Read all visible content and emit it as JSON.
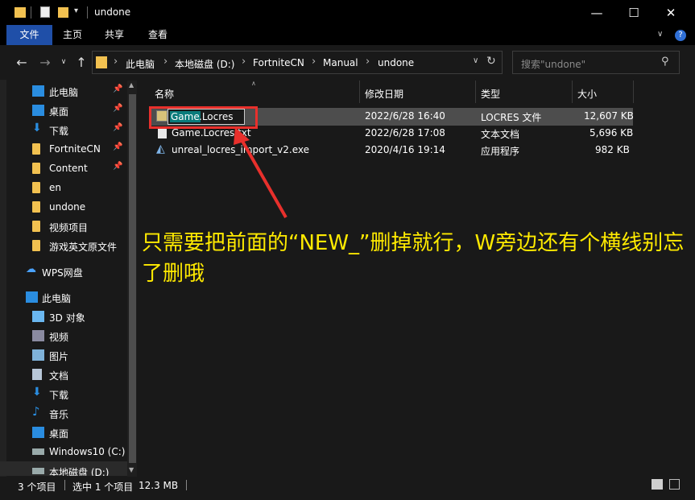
{
  "window": {
    "title": "undone",
    "controls": {
      "minimize": "—",
      "maximize": "☐",
      "close": "✕"
    }
  },
  "ribbon": {
    "tabs": [
      {
        "label": "文件",
        "active": true
      },
      {
        "label": "主页"
      },
      {
        "label": "共享"
      },
      {
        "label": "查看"
      }
    ]
  },
  "address": {
    "breadcrumb": [
      "此电脑",
      "本地磁盘 (D:)",
      "FortniteCN",
      "Manual",
      "undone"
    ],
    "search_placeholder": "搜索\"undone\""
  },
  "sidebar": {
    "items": [
      {
        "label": "此电脑",
        "icon": "pc-icon",
        "pinned": true
      },
      {
        "label": "桌面",
        "icon": "desktop-icon",
        "pinned": true
      },
      {
        "label": "下载",
        "icon": "download-icon",
        "pinned": true
      },
      {
        "label": "FortniteCN",
        "icon": "folder-icon",
        "pinned": true
      },
      {
        "label": "Content",
        "icon": "folder-icon",
        "pinned": true
      },
      {
        "label": "en",
        "icon": "folder-icon"
      },
      {
        "label": "undone",
        "icon": "folder-icon"
      },
      {
        "label": "视频项目",
        "icon": "folder-icon"
      },
      {
        "label": "游戏英文原文件",
        "icon": "folder-icon"
      },
      {
        "label": "WPS网盘",
        "icon": "cloud-icon"
      },
      {
        "label": "此电脑",
        "icon": "pc-icon"
      },
      {
        "label": "3D 对象",
        "icon": "3d-objects-icon"
      },
      {
        "label": "视频",
        "icon": "video-icon"
      },
      {
        "label": "图片",
        "icon": "picture-icon"
      },
      {
        "label": "文档",
        "icon": "document-icon"
      },
      {
        "label": "下载",
        "icon": "download-icon"
      },
      {
        "label": "音乐",
        "icon": "music-icon"
      },
      {
        "label": "桌面",
        "icon": "desktop-icon"
      },
      {
        "label": "Windows10 (C:)",
        "icon": "drive-icon"
      },
      {
        "label": "本地磁盘 (D:)",
        "icon": "drive-icon"
      }
    ]
  },
  "columns": [
    "名称",
    "修改日期",
    "类型",
    "大小"
  ],
  "files": [
    {
      "name_sel": "Game",
      "name_rest": ".Locres",
      "date": "2022/6/28 16:40",
      "type": "LOCRES 文件",
      "size": "12,607 KB",
      "icon": "locres-file-icon"
    },
    {
      "name": "Game.Locres.txt",
      "date": "2022/6/28 17:08",
      "type": "文本文档",
      "size": "5,696 KB",
      "icon": "text-file-icon"
    },
    {
      "name": "unreal_locres_import_v2.exe",
      "date": "2020/4/16 19:14",
      "type": "应用程序",
      "size": "982 KB",
      "icon": "exe-file-icon"
    }
  ],
  "status": {
    "count": "3 个项目",
    "selected": "选中 1 个项目",
    "size": "12.3 MB"
  },
  "annotation": {
    "text": "只需要把前面的“NEW_”删掉就行，W旁边还有个横线别忘了删哦",
    "color": "#ffea00",
    "box_color": "#e8302c"
  }
}
